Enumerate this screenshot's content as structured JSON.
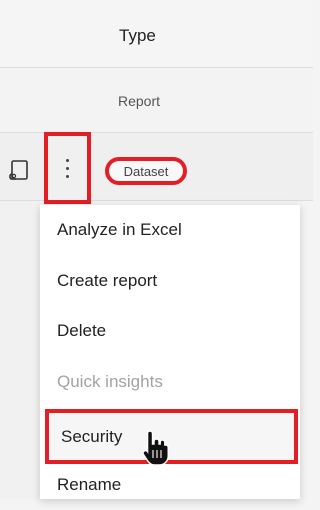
{
  "table": {
    "column_header": "Type",
    "rows": [
      {
        "type": "Report"
      },
      {
        "type": "Dataset"
      }
    ]
  },
  "menu": {
    "items": [
      {
        "label": "Analyze in Excel",
        "enabled": true
      },
      {
        "label": "Create report",
        "enabled": true
      },
      {
        "label": "Delete",
        "enabled": true
      },
      {
        "label": "Quick insights",
        "enabled": false
      },
      {
        "label": "Security",
        "enabled": true,
        "highlighted": true
      },
      {
        "label": "Rename",
        "enabled": true
      }
    ]
  },
  "colors": {
    "highlight": "#e31e24"
  },
  "icons": {
    "dataset_row_icon": "dataset-icon",
    "more_options": "more-vertical-icon",
    "pointer": "hand-cursor-icon"
  }
}
